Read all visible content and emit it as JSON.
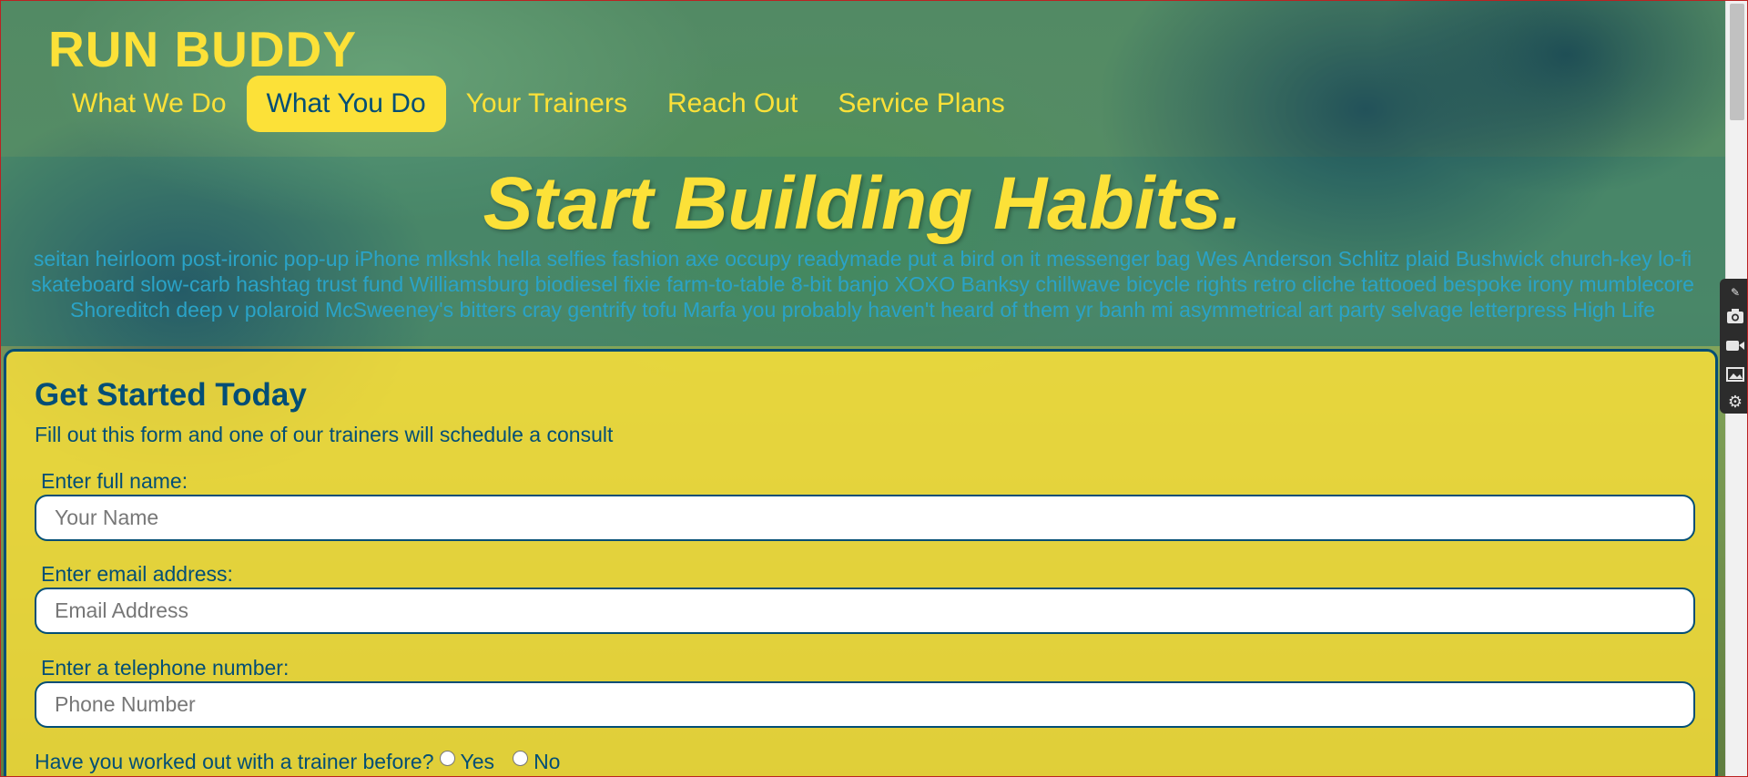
{
  "header": {
    "brand": "RUN BUDDY",
    "nav": [
      {
        "label": "What We Do",
        "active": false
      },
      {
        "label": "What You Do",
        "active": true
      },
      {
        "label": "Your Trainers",
        "active": false
      },
      {
        "label": "Reach Out",
        "active": false
      },
      {
        "label": "Service Plans",
        "active": false
      }
    ]
  },
  "hero": {
    "title": "Start Building Habits.",
    "body": "seitan heirloom post-ironic pop-up iPhone mlkshk hella selfies fashion axe occupy readymade put a bird on it messenger bag Wes Anderson Schlitz plaid Bushwick church-key lo-fi skateboard slow-carb hashtag trust fund Williamsburg biodiesel fixie farm-to-table 8-bit banjo XOXO Banksy chillwave bicycle rights retro cliche tattooed bespoke irony mumblecore Shoreditch deep v polaroid McSweeney's bitters cray gentrify tofu Marfa you probably haven't heard of them yr banh mi asymmetrical art party selvage letterpress High Life"
  },
  "form": {
    "title": "Get Started Today",
    "subtitle": "Fill out this form and one of our trainers will schedule a consult",
    "fields": [
      {
        "label": "Enter full name:",
        "placeholder": "Your Name",
        "value": ""
      },
      {
        "label": "Enter email address:",
        "placeholder": "Email Address",
        "value": ""
      },
      {
        "label": "Enter a telephone number:",
        "placeholder": "Phone Number",
        "value": ""
      }
    ],
    "question": "Have you worked out with a trainer before?",
    "options": [
      "Yes",
      "No"
    ]
  },
  "colors": {
    "accent": "#fce138",
    "primary": "#024e76"
  },
  "side_tools": [
    "camera-icon",
    "video-icon",
    "image-icon",
    "gear-icon"
  ]
}
